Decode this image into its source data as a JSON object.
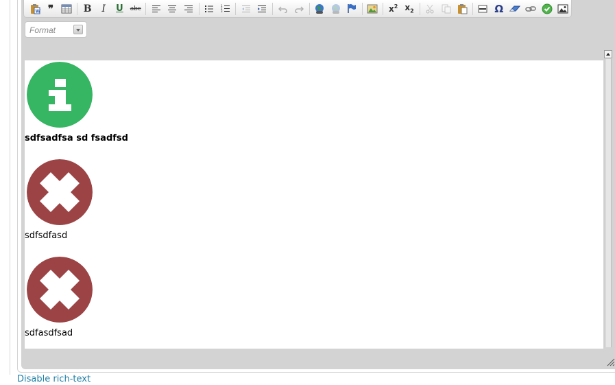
{
  "toolbar": {
    "buttons": [
      {
        "name": "paste-from-word-button",
        "icon": "paste-word-icon"
      },
      {
        "name": "blockquote-button",
        "icon": "quote-icon",
        "glyph": "❞"
      },
      {
        "name": "table-button",
        "icon": "table-icon"
      },
      {
        "name": "bold-button",
        "icon": "bold-icon",
        "glyph": "B"
      },
      {
        "name": "italic-button",
        "icon": "italic-icon",
        "glyph": "I"
      },
      {
        "name": "underline-button",
        "icon": "underline-icon",
        "glyph": "U"
      },
      {
        "name": "strikethrough-button",
        "icon": "strikethrough-icon",
        "glyph": "abc"
      },
      {
        "name": "align-left-button",
        "icon": "align-left-icon"
      },
      {
        "name": "align-center-button",
        "icon": "align-center-icon"
      },
      {
        "name": "align-right-button",
        "icon": "align-right-icon"
      },
      {
        "name": "bulleted-list-button",
        "icon": "bulleted-list-icon"
      },
      {
        "name": "numbered-list-button",
        "icon": "numbered-list-icon"
      },
      {
        "name": "outdent-button",
        "icon": "outdent-icon"
      },
      {
        "name": "indent-button",
        "icon": "indent-icon"
      },
      {
        "name": "undo-button",
        "icon": "undo-icon"
      },
      {
        "name": "redo-button",
        "icon": "redo-icon"
      },
      {
        "name": "link-button",
        "icon": "link-globe-icon"
      },
      {
        "name": "unlink-button",
        "icon": "unlink-globe-icon"
      },
      {
        "name": "anchor-button",
        "icon": "flag-icon"
      },
      {
        "name": "image-button",
        "icon": "image-icon"
      },
      {
        "name": "superscript-button",
        "icon": "superscript-icon",
        "glyph": "x",
        "script": "2"
      },
      {
        "name": "subscript-button",
        "icon": "subscript-icon",
        "glyph": "x",
        "script": "2"
      },
      {
        "name": "cut-button",
        "icon": "scissors-icon"
      },
      {
        "name": "copy-button",
        "icon": "copy-icon"
      },
      {
        "name": "paste-button",
        "icon": "paste-icon"
      },
      {
        "name": "horizontal-rule-button",
        "icon": "horizontal-rule-icon"
      },
      {
        "name": "special-char-button",
        "icon": "omega-icon",
        "glyph": "Ω"
      },
      {
        "name": "remove-format-button",
        "icon": "eraser-icon"
      },
      {
        "name": "insert-link-button",
        "icon": "chain-icon"
      },
      {
        "name": "spellcheck-button",
        "icon": "check-circle-icon"
      },
      {
        "name": "insert-media-button",
        "icon": "media-icon"
      }
    ]
  },
  "format": {
    "placeholder": "Format"
  },
  "content": {
    "blocks": [
      {
        "icon": "info-icon",
        "color": "#36b563",
        "caption": "sdfsadfsa sd fsadfsd",
        "bold": true
      },
      {
        "icon": "error-x-icon",
        "color": "#9c4445",
        "caption": "sdfsdfasd",
        "bold": false
      },
      {
        "icon": "error-x-icon",
        "color": "#9c4445",
        "caption": "sdfasdfsad",
        "bold": false
      }
    ]
  },
  "footer": {
    "disable_link": "Disable rich-text"
  },
  "colors": {
    "link": "#1f7fa6",
    "info": "#36b563",
    "error": "#9c4445",
    "editor_bg": "#d3d3d3"
  }
}
